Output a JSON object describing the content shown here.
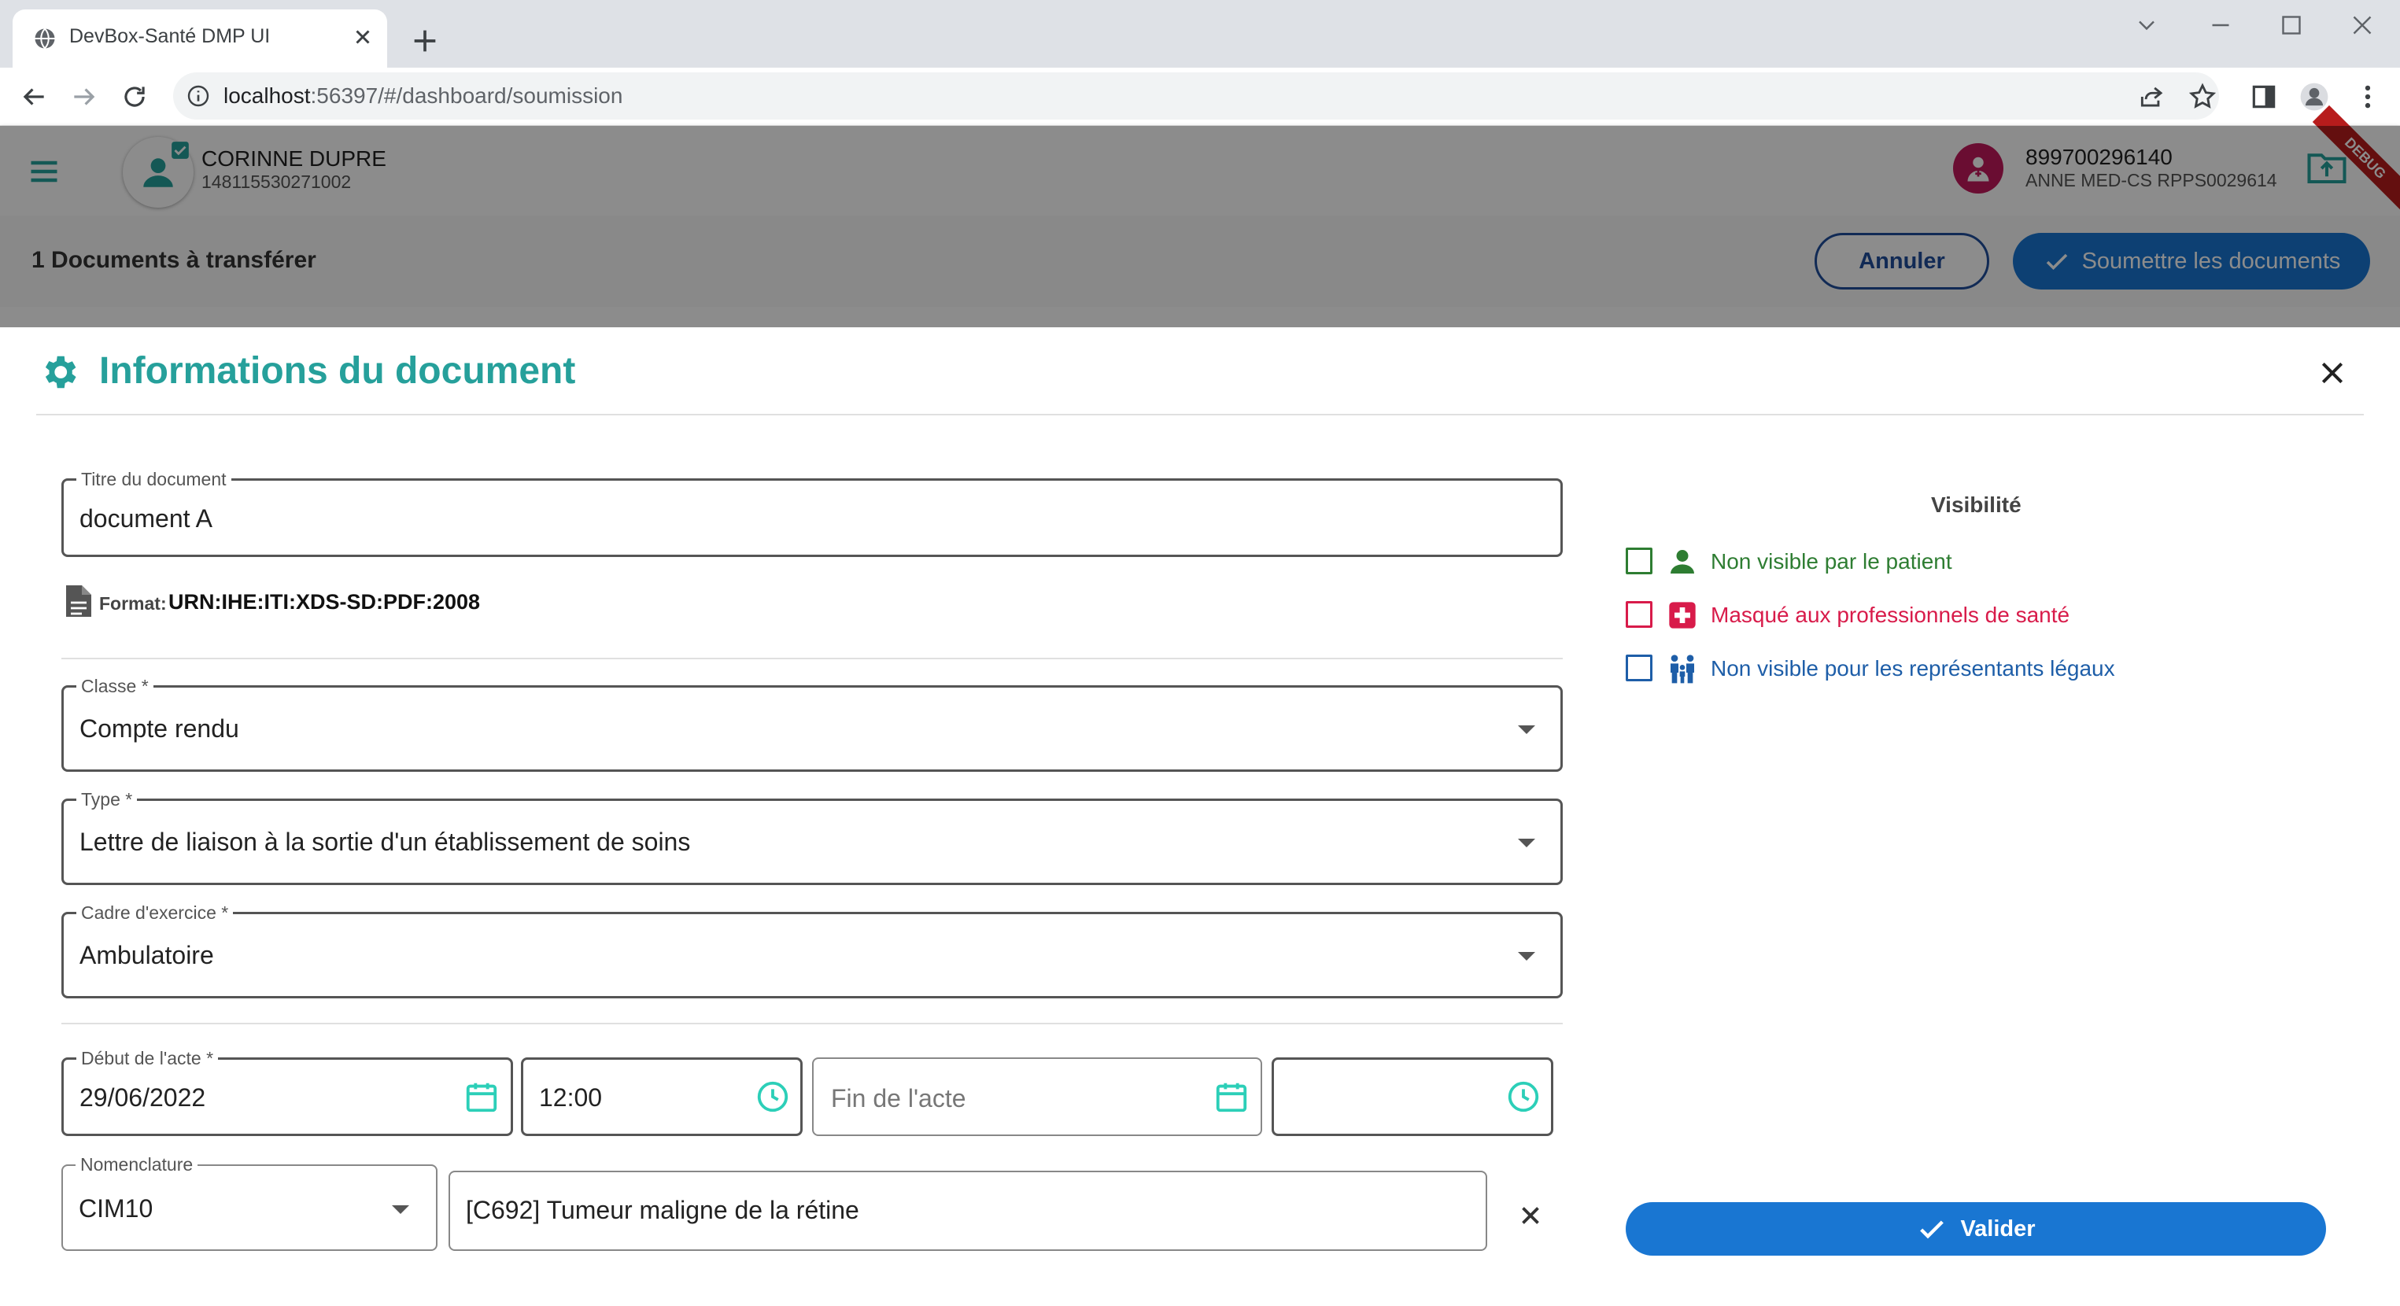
{
  "browser": {
    "tab_title": "DevBox-Santé DMP UI",
    "url_host": "localhost",
    "url_rest": ":56397/#/dashboard/soumission"
  },
  "header": {
    "patient_name": "CORINNE DUPRE",
    "patient_id": "148115530271002",
    "pro_id": "899700296140",
    "pro_name": "ANNE MED-CS RPPS0029614",
    "debug_label": "DEBUG"
  },
  "subbar": {
    "count": "1",
    "title": " Documents à transférer",
    "cancel_label": "Annuler",
    "submit_label": "Soumettre les documents"
  },
  "dialog": {
    "title": "Informations du document",
    "titre_label": "Titre du document",
    "titre_value": "document A",
    "format_label": "Format:",
    "format_value": "URN:IHE:ITI:XDS-SD:PDF:2008",
    "classe_label": "Classe *",
    "classe_value": "Compte rendu",
    "type_label": "Type *",
    "type_value": "Lettre de liaison à la sortie d'un établissement de soins",
    "cadre_label": "Cadre d'exercice *",
    "cadre_value": "Ambulatoire",
    "debut_label": "Début de l'acte *",
    "debut_date": "29/06/2022",
    "debut_time": "12:00",
    "fin_placeholder": "Fin de l'acte",
    "fin_time": "",
    "nomenclature_label": "Nomenclature",
    "nomenclature_value": "CIM10",
    "code_value": "[C692] Tumeur maligne de la rétine",
    "validate_label": "Valider"
  },
  "visibility": {
    "title": "Visibilité",
    "options": [
      {
        "label": "Non visible par le patient",
        "color": "#2e7d32",
        "checked": false
      },
      {
        "label": "Masqué aux professionnels de santé",
        "color": "#d81b4a",
        "checked": false
      },
      {
        "label": "Non visible pour les représentants légaux",
        "color": "#1e5ea8",
        "checked": false
      }
    ]
  },
  "colors": {
    "accent": "#26a09b",
    "primary": "#1976d2"
  }
}
